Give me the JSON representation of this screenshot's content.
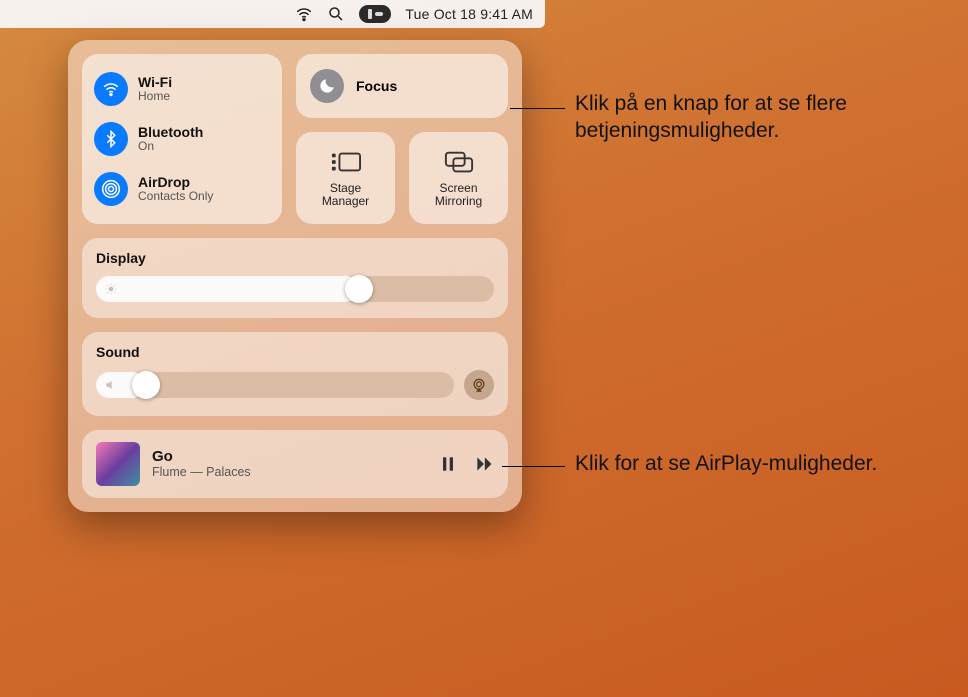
{
  "menubar": {
    "datetime": "Tue Oct 18  9:41 AM"
  },
  "connectivity": {
    "wifi": {
      "title": "Wi-Fi",
      "sub": "Home"
    },
    "bluetooth": {
      "title": "Bluetooth",
      "sub": "On"
    },
    "airdrop": {
      "title": "AirDrop",
      "sub": "Contacts Only"
    }
  },
  "focus": {
    "label": "Focus"
  },
  "mini": {
    "stage": "Stage\nManager",
    "mirror": "Screen\nMirroring"
  },
  "display": {
    "title": "Display",
    "pct": 66
  },
  "sound": {
    "title": "Sound",
    "pct": 14
  },
  "nowplaying": {
    "title": "Go",
    "sub": "Flume — Palaces"
  },
  "callouts": {
    "buttons": "Klik på en knap for at se flere betjeningsmuligheder.",
    "airplay": "Klik for at se AirPlay-muligheder."
  }
}
